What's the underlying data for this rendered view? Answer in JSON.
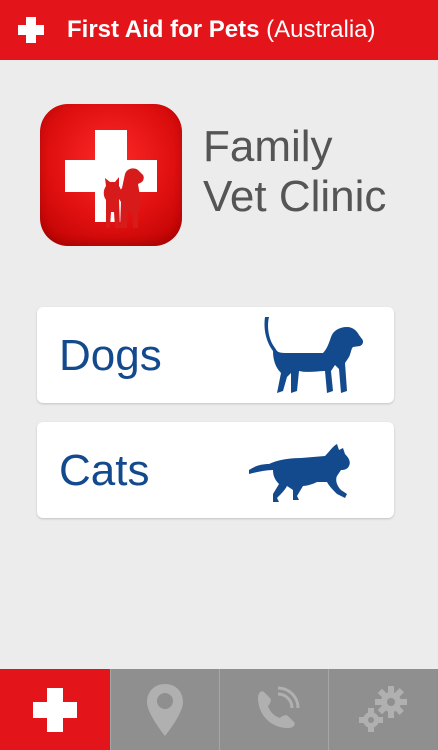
{
  "header": {
    "title_bold": "First Aid for Pets",
    "title_region": "(Australia)",
    "icon": "cross-icon"
  },
  "clinic": {
    "line1": "Family",
    "line2": "Vet Clinic",
    "logo_icon": "cross-with-pets-logo"
  },
  "menu": {
    "items": [
      {
        "label": "Dogs",
        "icon": "dog-icon"
      },
      {
        "label": "Cats",
        "icon": "cat-icon"
      }
    ]
  },
  "tabs": [
    {
      "icon": "cross-icon",
      "active": true
    },
    {
      "icon": "location-pin-icon",
      "active": false
    },
    {
      "icon": "phone-icon",
      "active": false
    },
    {
      "icon": "gears-icon",
      "active": false
    }
  ],
  "colors": {
    "brand_red": "#e3151b",
    "accent_blue": "#134a8e",
    "tab_gray": "#8f8f8f",
    "background": "#ececec"
  }
}
